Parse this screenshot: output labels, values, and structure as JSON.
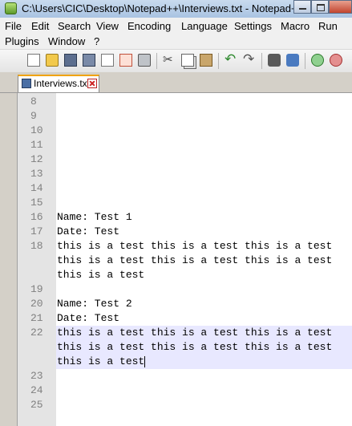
{
  "window": {
    "title": "C:\\Users\\CIC\\Desktop\\Notepad++\\Interviews.txt - Notepad++"
  },
  "menu": {
    "row1": [
      "File",
      "Edit",
      "Search",
      "View",
      "Encoding",
      "Language",
      "Settings",
      "Macro",
      "Run"
    ],
    "row2": [
      "Plugins",
      "Window",
      "?"
    ]
  },
  "toolbar": {
    "icons": [
      "new-file-icon",
      "open-file-icon",
      "save-icon",
      "save-all-icon",
      "close-icon",
      "close-all-icon",
      "print-icon",
      "cut-icon",
      "copy-icon",
      "paste-icon",
      "undo-icon",
      "redo-icon",
      "find-icon",
      "replace-icon",
      "zoom-in-icon",
      "zoom-out-icon"
    ]
  },
  "tab": {
    "label": "Interviews.txt"
  },
  "editor": {
    "lines": [
      {
        "n": "8",
        "text": ""
      },
      {
        "n": "9",
        "text": ""
      },
      {
        "n": "10",
        "text": ""
      },
      {
        "n": "11",
        "text": ""
      },
      {
        "n": "12",
        "text": ""
      },
      {
        "n": "13",
        "text": ""
      },
      {
        "n": "14",
        "text": ""
      },
      {
        "n": "15",
        "text": ""
      },
      {
        "n": "16",
        "text": "Name: Test 1"
      },
      {
        "n": "17",
        "text": "Date: Test"
      },
      {
        "n": "18",
        "text": "this is a test this is a test this is a test"
      },
      {
        "n": "",
        "text": "this is a test this is a test this is a test"
      },
      {
        "n": "",
        "text": "this is a test"
      },
      {
        "n": "19",
        "text": ""
      },
      {
        "n": "20",
        "text": "Name: Test 2"
      },
      {
        "n": "21",
        "text": "Date: Test"
      },
      {
        "n": "22",
        "text": "this is a test this is a test this is a test"
      },
      {
        "n": "",
        "text": "this is a test this is a test this is a test"
      },
      {
        "n": "",
        "text": "this is a test"
      },
      {
        "n": "23",
        "text": ""
      },
      {
        "n": "24",
        "text": ""
      },
      {
        "n": "25",
        "text": ""
      }
    ]
  }
}
